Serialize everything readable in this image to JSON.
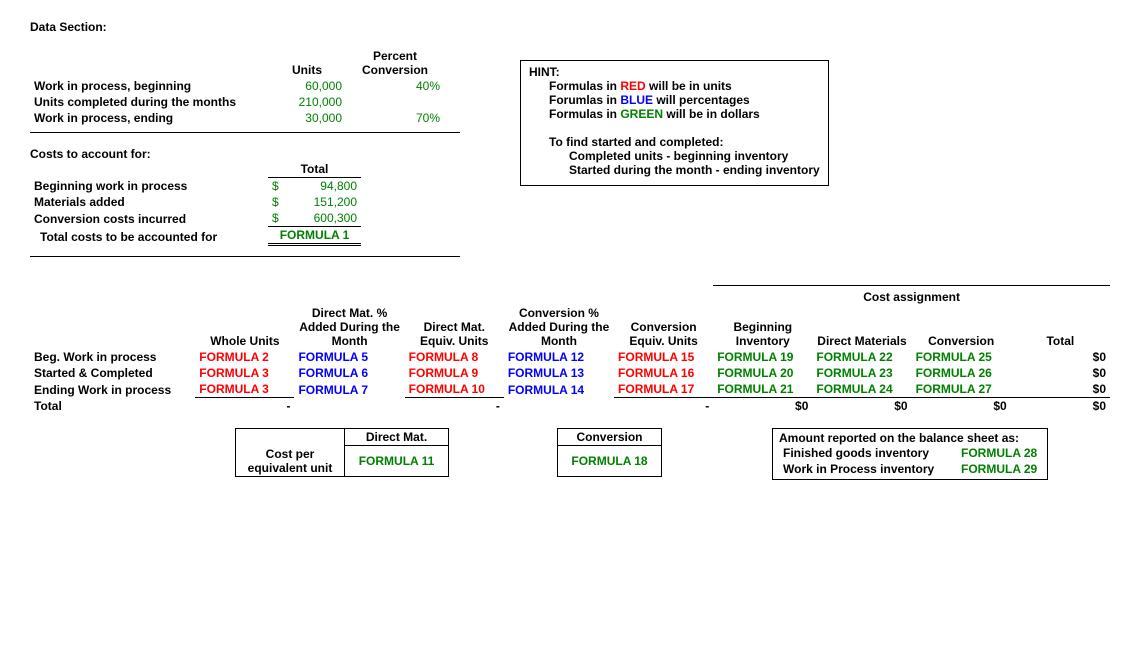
{
  "section_title": "Data Section:",
  "data_headers": {
    "units": "Units",
    "percent": "Percent Conversion"
  },
  "data_rows": {
    "wip_begin": {
      "label": "Work in process, beginning",
      "units": "60,000",
      "pct": "40%"
    },
    "units_completed": {
      "label": "Units completed during the months",
      "units": "210,000",
      "pct": ""
    },
    "wip_end": {
      "label": "Work in process, ending",
      "units": "30,000",
      "pct": "70%"
    }
  },
  "costs_header": "Costs to account for:",
  "total_header": "Total",
  "costs": {
    "bwip": {
      "label": "Beginning work in process",
      "prefix": "$",
      "val": "94,800"
    },
    "mat": {
      "label": "Materials added",
      "prefix": "$",
      "val": "151,200"
    },
    "conv": {
      "label": "Conversion costs incurred",
      "prefix": "$",
      "val": "600,300"
    }
  },
  "total_costs_label": "Total costs to be accounted for",
  "formula1": "FORMULA 1",
  "hint": {
    "title": "HINT:",
    "line1_a": "Formulas in ",
    "line1_b": "RED",
    "line1_c": " will be in units",
    "line2_a": "Forumlas in ",
    "line2_b": "BLUE",
    "line2_c": " will percentages",
    "line3_a": "Formulas in ",
    "line3_b": "GREEN",
    "line3_c": " will be in dollars",
    "line4": "To find started and completed:",
    "line5": "Completed units - beginning inventory",
    "line6": "Started during the month - ending inventory"
  },
  "headers2": {
    "cost_assignment": "Cost assignment",
    "whole": "Whole Units",
    "dm_pct": "Direct Mat. % Added During the Month",
    "dm_eq": "Direct Mat. Equiv. Units",
    "conv_pct": "Conversion % Added During the Month",
    "conv_eq": "Conversion Equiv. Units",
    "beg_inv": "Beginning Inventory",
    "dm": "Direct Materials",
    "conv": "Conversion",
    "total": "Total"
  },
  "rows2": {
    "r1label": "Beg. Work in process",
    "r2label": "Started & Completed",
    "r3label": "Ending Work in process",
    "r4label": "Total",
    "f2": "FORMULA 2",
    "f3": "FORMULA 3",
    "f3b": "FORMULA 3",
    "f5": "FORMULA 5",
    "f6": "FORMULA 6",
    "f7": "FORMULA 7",
    "f8": "FORMULA 8",
    "f9": "FORMULA 9",
    "f10": "FORMULA 10",
    "f12": "FORMULA 12",
    "f13": "FORMULA 13",
    "f14": "FORMULA 14",
    "f15": "FORMULA 15",
    "f16": "FORMULA 16",
    "f17": "FORMULA 17",
    "f19": "FORMULA 19",
    "f20": "FORMULA 20",
    "f21": "FORMULA 21",
    "f22": "FORMULA 22",
    "f23": "FORMULA 23",
    "f24": "FORMULA 24",
    "f25": "FORMULA 25",
    "f26": "FORMULA 26",
    "f27": "FORMULA 27",
    "dash": "-",
    "zero": "$0"
  },
  "cost_per": {
    "label": "Cost per equivalent unit",
    "dm_header": "Direct Mat.",
    "conv_header": "Conversion",
    "f11": "FORMULA 11",
    "f18": "FORMULA 18"
  },
  "balance": {
    "title": "Amount reported on the balance sheet as:",
    "fg": "Finished goods inventory",
    "wip": "Work in Process inventory",
    "f28": "FORMULA 28",
    "f29": "FORMULA 29"
  }
}
